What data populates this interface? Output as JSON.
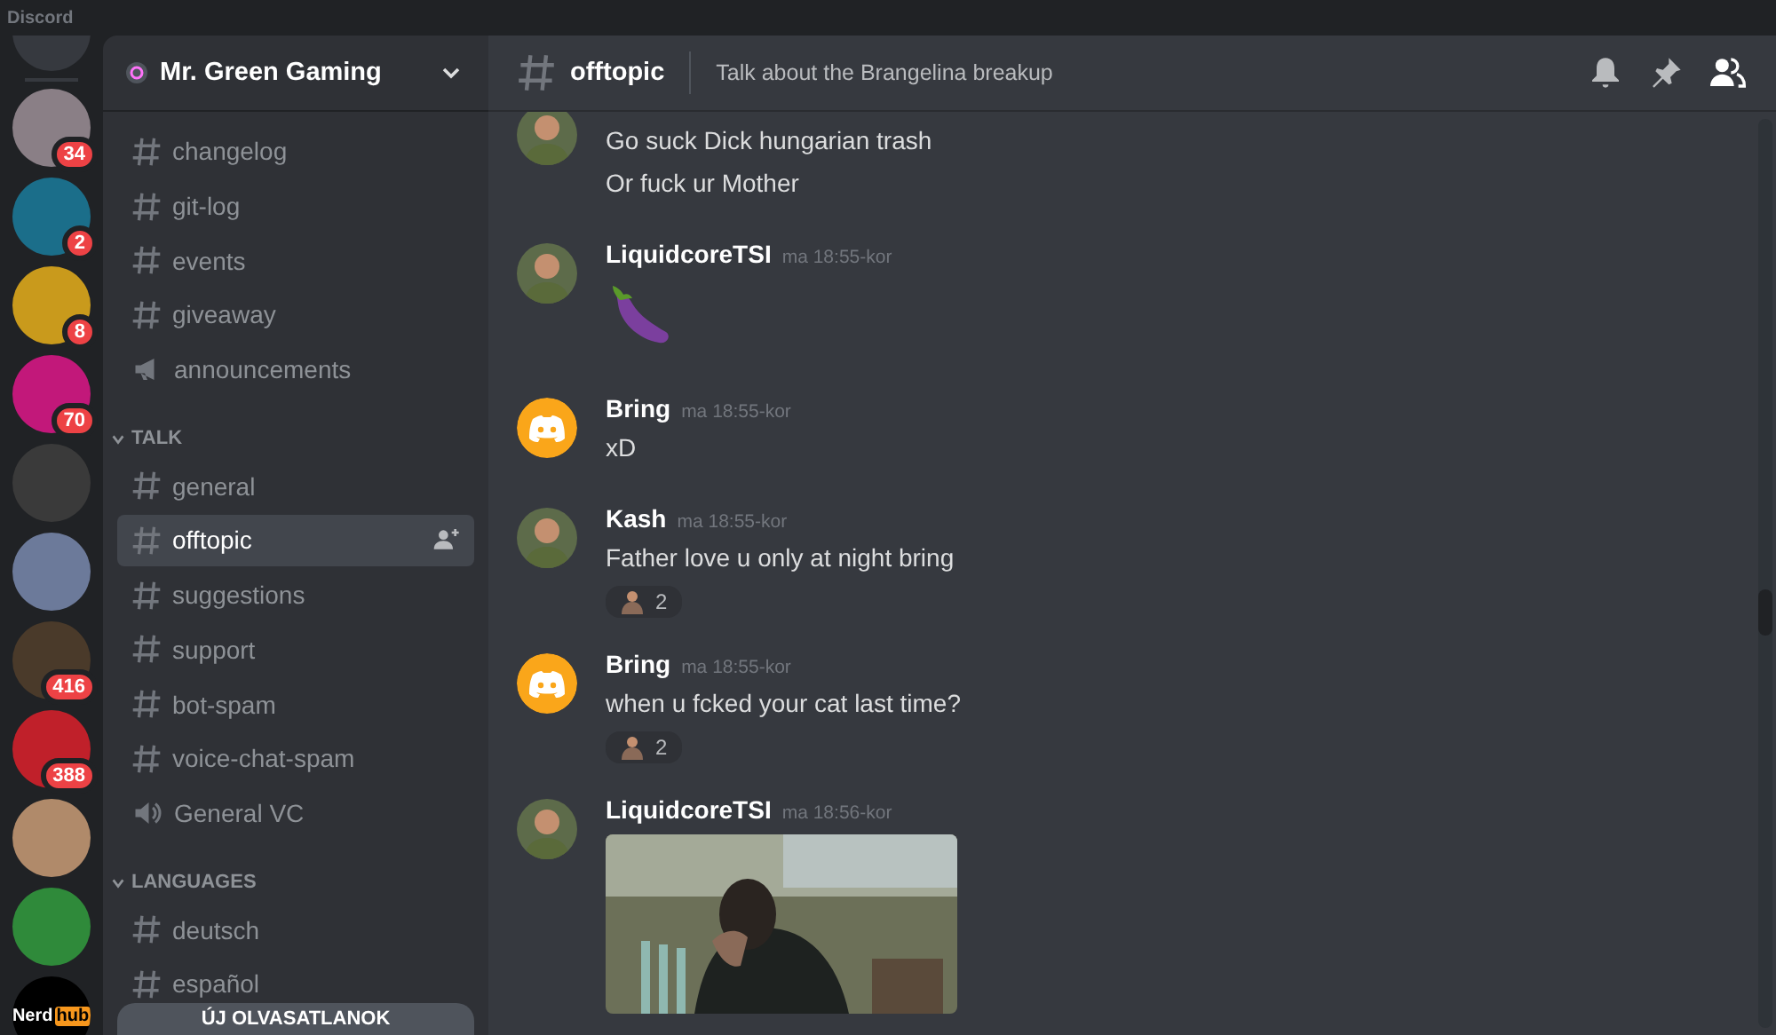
{
  "app_title": "Discord",
  "servers": [
    {
      "badge": "34",
      "color": "#8a7f86"
    },
    {
      "badge": "2",
      "color": "#1b6e8a"
    },
    {
      "badge": "8",
      "color": "#c99a1c"
    },
    {
      "badge": "70",
      "color": "#c2187a"
    },
    {
      "color": "#3a3a3a"
    },
    {
      "color": "#6c7a9a"
    },
    {
      "badge": "416",
      "color": "#4a3a2a"
    },
    {
      "badge": "388",
      "color": "#c0202a"
    },
    {
      "color": "#b08a6a"
    },
    {
      "color": "#2f8a3a"
    },
    {
      "color": "#000000",
      "label": "Nerd",
      "label_tag": "hub"
    }
  ],
  "server_name": "Mr. Green Gaming",
  "channels": [
    {
      "kind": "text",
      "name": "changelog",
      "selected": false
    },
    {
      "kind": "text",
      "name": "git-log",
      "selected": false
    },
    {
      "kind": "text",
      "name": "events",
      "selected": false
    },
    {
      "kind": "text",
      "name": "giveaway",
      "selected": false
    },
    {
      "kind": "announcement",
      "name": "announcements",
      "selected": false
    },
    {
      "kind": "category",
      "name": "TALK",
      "expanded": true
    },
    {
      "kind": "text",
      "name": "general",
      "selected": false
    },
    {
      "kind": "text",
      "name": "offtopic",
      "selected": true
    },
    {
      "kind": "text",
      "name": "suggestions",
      "selected": false
    },
    {
      "kind": "text",
      "name": "support",
      "selected": false
    },
    {
      "kind": "text",
      "name": "bot-spam",
      "selected": false
    },
    {
      "kind": "text",
      "name": "voice-chat-spam",
      "selected": false
    },
    {
      "kind": "voice",
      "name": "General VC",
      "selected": false
    },
    {
      "kind": "category",
      "name": "LANGUAGES",
      "expanded": true
    },
    {
      "kind": "text",
      "name": "deutsch",
      "selected": false
    },
    {
      "kind": "text",
      "name": "español",
      "selected": false
    }
  ],
  "unread_button": "ÚJ OLVASATLANOK",
  "header": {
    "channel": "offtopic",
    "topic": "Talk about the Brangelina breakup"
  },
  "messages": [
    {
      "kind": "user",
      "content": [
        {
          "kind": "text",
          "text": "Go suck Dick hungarian trash"
        },
        {
          "kind": "text",
          "text": "Or fuck ur Mother"
        }
      ]
    },
    {
      "kind": "user",
      "author": "LiquidcoreTSI",
      "time": "ma 18:55-kor",
      "content": [
        {
          "kind": "emoji"
        }
      ]
    },
    {
      "kind": "bot",
      "author": "Bring",
      "time": "ma 18:55-kor",
      "content": [
        {
          "kind": "text",
          "text": "xD"
        }
      ]
    },
    {
      "kind": "user",
      "author": "Kash",
      "time": "ma 18:55-kor",
      "content": [
        {
          "kind": "text",
          "text": "Father love u only at night bring"
        }
      ],
      "reactions": [
        {
          "count": "2"
        }
      ]
    },
    {
      "kind": "bot",
      "author": "Bring",
      "time": "ma 18:55-kor",
      "content": [
        {
          "kind": "text",
          "text": "when u fcked your cat last time?"
        }
      ],
      "reactions": [
        {
          "count": "2"
        }
      ]
    },
    {
      "kind": "user",
      "author": "LiquidcoreTSI",
      "time": "ma 18:56-kor"
    }
  ]
}
